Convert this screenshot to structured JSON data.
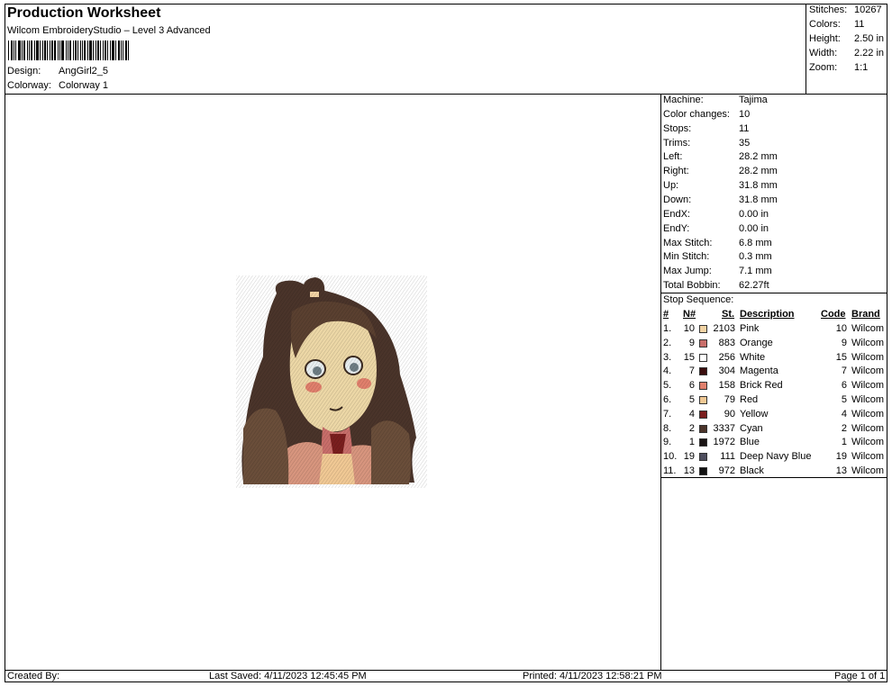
{
  "header": {
    "title": "Production Worksheet",
    "subtitle": "Wilcom EmbroideryStudio – Level 3 Advanced",
    "design_label": "Design:",
    "design_value": "AngGirl2_5",
    "colorway_label": "Colorway:",
    "colorway_value": "Colorway 1"
  },
  "summary": [
    {
      "label": "Stitches:",
      "value": "10267"
    },
    {
      "label": "Colors:",
      "value": "11"
    },
    {
      "label": "Height:",
      "value": "2.50 in"
    },
    {
      "label": "Width:",
      "value": "2.22 in"
    },
    {
      "label": "Zoom:",
      "value": "1:1"
    }
  ],
  "machine_info": [
    {
      "label": "Machine:",
      "value": "Tajima"
    },
    {
      "label": "Color changes:",
      "value": "10"
    },
    {
      "label": "Stops:",
      "value": "11"
    },
    {
      "label": "Trims:",
      "value": "35"
    },
    {
      "label": "Left:",
      "value": "28.2 mm"
    },
    {
      "label": "Right:",
      "value": "28.2 mm"
    },
    {
      "label": "Up:",
      "value": "31.8 mm"
    },
    {
      "label": "Down:",
      "value": "31.8 mm"
    },
    {
      "label": "EndX:",
      "value": "0.00 in"
    },
    {
      "label": "EndY:",
      "value": "0.00 in"
    },
    {
      "label": "Max Stitch:",
      "value": "6.8 mm"
    },
    {
      "label": "Min Stitch:",
      "value": "0.3 mm"
    },
    {
      "label": "Max Jump:",
      "value": "7.1 mm"
    },
    {
      "label": "Total Bobbin:",
      "value": "62.27ft"
    }
  ],
  "stop_sequence": {
    "title": "Stop Sequence:",
    "columns": {
      "idx": "#",
      "n": "N#",
      "st": "St.",
      "desc": "Description",
      "code": "Code",
      "brand": "Brand"
    },
    "rows": [
      {
        "idx": "1.",
        "n": "10",
        "st": "2103",
        "desc": "Pink",
        "code": "10",
        "brand": "Wilcom",
        "color": "#f2d3a4"
      },
      {
        "idx": "2.",
        "n": "9",
        "st": "883",
        "desc": "Orange",
        "code": "9",
        "brand": "Wilcom",
        "color": "#c86e6a"
      },
      {
        "idx": "3.",
        "n": "15",
        "st": "256",
        "desc": "White",
        "code": "15",
        "brand": "Wilcom",
        "color": "#ffffff"
      },
      {
        "idx": "4.",
        "n": "7",
        "st": "304",
        "desc": "Magenta",
        "code": "7",
        "brand": "Wilcom",
        "color": "#3a0d0d"
      },
      {
        "idx": "5.",
        "n": "6",
        "st": "158",
        "desc": "Brick Red",
        "code": "6",
        "brand": "Wilcom",
        "color": "#e07f6c"
      },
      {
        "idx": "6.",
        "n": "5",
        "st": "79",
        "desc": "Red",
        "code": "5",
        "brand": "Wilcom",
        "color": "#f0c894"
      },
      {
        "idx": "7.",
        "n": "4",
        "st": "90",
        "desc": "Yellow",
        "code": "4",
        "brand": "Wilcom",
        "color": "#7a1e1e"
      },
      {
        "idx": "8.",
        "n": "2",
        "st": "3337",
        "desc": "Cyan",
        "code": "2",
        "brand": "Wilcom",
        "color": "#4a342a"
      },
      {
        "idx": "9.",
        "n": "1",
        "st": "1972",
        "desc": "Blue",
        "code": "1",
        "brand": "Wilcom",
        "color": "#1a1414"
      },
      {
        "idx": "10.",
        "n": "19",
        "st": "111",
        "desc": "Deep Navy Blue",
        "code": "19",
        "brand": "Wilcom",
        "color": "#4e4e5e"
      },
      {
        "idx": "11.",
        "n": "13",
        "st": "972",
        "desc": "Black",
        "code": "13",
        "brand": "Wilcom",
        "color": "#111111"
      }
    ]
  },
  "footer": {
    "created_by": "Created By:",
    "last_saved": "Last Saved: 4/11/2023 12:45:45 PM",
    "printed": "Printed: 4/11/2023 12:58:21 PM",
    "page": "Page 1 of 1"
  }
}
